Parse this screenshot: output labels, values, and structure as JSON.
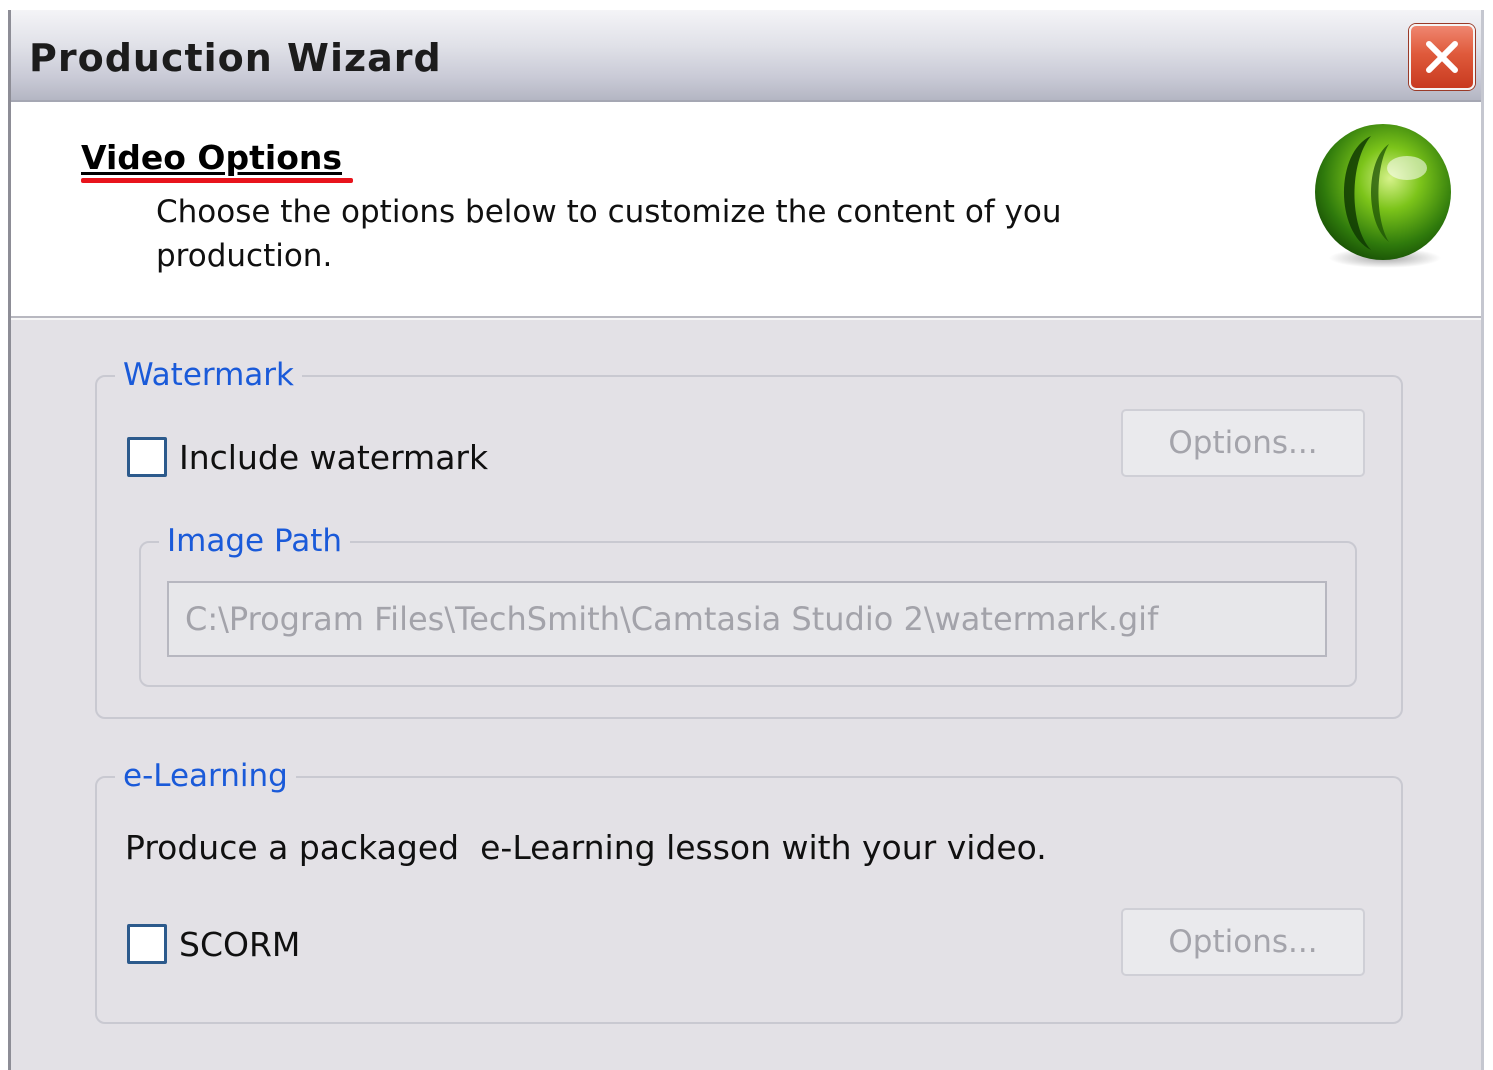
{
  "window": {
    "title": "Production Wizard",
    "close_icon": "close-icon"
  },
  "header": {
    "title": "Video Options",
    "description": "Choose the options below to customize the content of you production.",
    "logo_icon": "camtasia-logo-icon",
    "underline_color": "#e8141c"
  },
  "watermark": {
    "legend": "Watermark",
    "checkbox_label": "Include watermark",
    "checked": false,
    "options_label": "Options...",
    "image_path": {
      "legend": "Image Path",
      "value": "C:\\Program Files\\TechSmith\\Camtasia Studio 2\\watermark.gif"
    }
  },
  "elearning": {
    "legend": "e-Learning",
    "description": "Produce a packaged  e-Learning lesson with your video.",
    "checkbox_label": "SCORM",
    "checked": false,
    "options_label": "Options..."
  },
  "colors": {
    "legend_text": "#1a5ad9",
    "dialog_bg": "#e3e1e6",
    "close_button": "#df5a3b"
  }
}
